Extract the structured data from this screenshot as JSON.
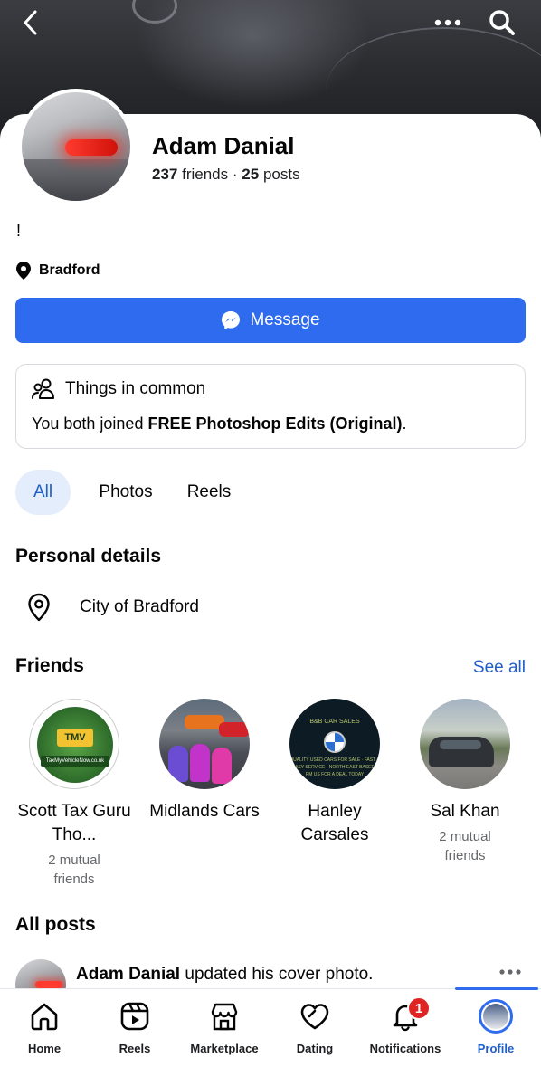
{
  "profile": {
    "name": "Adam Danial",
    "friends_count": "237",
    "friends_label": "friends",
    "separator": "·",
    "posts_count": "25",
    "posts_label": "posts",
    "bio": "!",
    "location": "Bradford"
  },
  "actions": {
    "message_label": "Message"
  },
  "things_in_common": {
    "title": "Things in common",
    "text_prefix": "You both joined ",
    "group_name": "FREE Photoshop Edits (Original)",
    "text_suffix": "."
  },
  "tabs": [
    {
      "label": "All",
      "active": true
    },
    {
      "label": "Photos",
      "active": false
    },
    {
      "label": "Reels",
      "active": false
    }
  ],
  "personal_details": {
    "title": "Personal details",
    "city": "City of Bradford"
  },
  "friends_section": {
    "title": "Friends",
    "see_all": "See all",
    "items": [
      {
        "name": "Scott Tax Guru Tho...",
        "mutual": "2 mutual friends"
      },
      {
        "name": "Midlands Cars",
        "mutual": ""
      },
      {
        "name": "Hanley Carsales",
        "mutual": ""
      },
      {
        "name": "Sal Khan",
        "mutual": "2 mutual friends"
      }
    ],
    "thumb_text": {
      "tmv": "TMV",
      "tmv_url": "TaxMyVehicleNow.co.uk",
      "bb_title": "B&B CAR SALES",
      "bb_lines": "QUALITY USED CARS FOR SALE · FAST & EASY SERVICE · NORTH EAST BASED · PM US FOR A DEAL TODAY"
    }
  },
  "all_posts": {
    "title": "All posts",
    "post_author": "Adam Danial",
    "post_action": " updated his cover photo."
  },
  "bottom_nav": [
    {
      "label": "Home",
      "icon": "home-icon"
    },
    {
      "label": "Reels",
      "icon": "reels-icon"
    },
    {
      "label": "Marketplace",
      "icon": "marketplace-icon"
    },
    {
      "label": "Dating",
      "icon": "dating-icon"
    },
    {
      "label": "Notifications",
      "icon": "bell-icon",
      "badge": "1"
    },
    {
      "label": "Profile",
      "icon": "profile-avatar",
      "active": true
    }
  ],
  "colors": {
    "accent": "#2f6bef",
    "link": "#1f5fc9",
    "badge": "#e02424"
  }
}
